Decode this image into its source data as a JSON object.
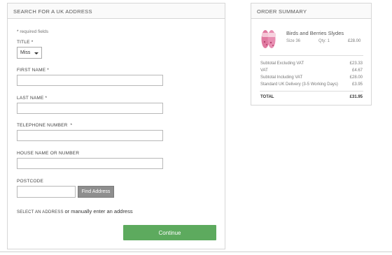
{
  "address_form": {
    "header": "SEARCH FOR A UK ADDRESS",
    "required_star": "*",
    "required_note": "required fields",
    "title_label": "TITLE",
    "title_value": "Miss",
    "first_name_label": "FIRST NAME",
    "first_name_value": "",
    "last_name_label": "LAST NAME",
    "last_name_value": "",
    "telephone_label": "TELEPHONE NUMBER",
    "telephone_value": "",
    "house_label": "HOUSE NAME OR NUMBER",
    "house_value": "",
    "postcode_label": "POSTCODE",
    "postcode_value": "",
    "find_button": "Find Address",
    "select_address_text": "SELECT AN ADDRESS",
    "manual_text": "or manually enter an address",
    "continue_button": "Continue"
  },
  "order_summary": {
    "header": "ORDER SUMMARY",
    "product": {
      "name": "Birds and Berries Slydes",
      "size": "Size 36",
      "qty": "Qty: 1",
      "price": "£28.00"
    },
    "rows": [
      {
        "label": "Subtotal Excluding VAT",
        "value": "£23.33"
      },
      {
        "label": "VAT",
        "value": "£4.67"
      },
      {
        "label": "Subtotal Including VAT",
        "value": "£28.00"
      },
      {
        "label": "Standard UK Delivery (3-5 Working Days)",
        "value": "£3.95"
      }
    ],
    "total": {
      "label": "TOTAL",
      "value": "£31.95"
    }
  },
  "colors": {
    "continue": "#5daa5e",
    "find_button": "#8e8e8e",
    "product_pink": "#e07aa0"
  }
}
